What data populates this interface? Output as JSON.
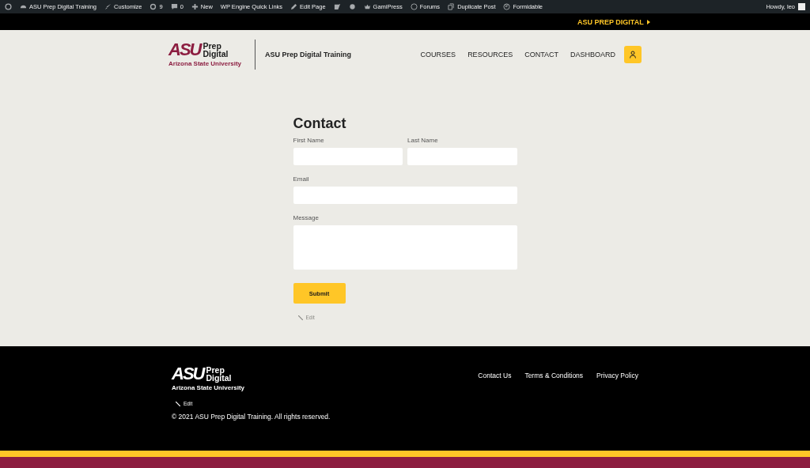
{
  "admin_bar": {
    "items": [
      {
        "kind": "wp"
      },
      {
        "kind": "home",
        "label": "ASU Prep Digital Training"
      },
      {
        "kind": "brush",
        "label": "Customize"
      },
      {
        "kind": "update",
        "label": "9"
      },
      {
        "kind": "comment",
        "label": "0"
      },
      {
        "kind": "plus",
        "label": "New"
      },
      {
        "kind": "text",
        "label": "WP Engine Quick Links"
      },
      {
        "kind": "pencil",
        "label": "Edit Page"
      },
      {
        "kind": "yoast"
      },
      {
        "kind": "dot"
      },
      {
        "kind": "crown",
        "label": "GamiPress"
      },
      {
        "kind": "circle",
        "label": "Forums"
      },
      {
        "kind": "copy",
        "label": "Duplicate Post"
      },
      {
        "kind": "formidable",
        "label": "Formidable"
      }
    ],
    "greeting": "Howdy, leo"
  },
  "top_link": "ASU PREP DIGITAL",
  "header": {
    "logo": {
      "mark": "ASU",
      "name": "Prep Digital",
      "university": "Arizona State University"
    },
    "site_title": "ASU Prep Digital Training",
    "nav": [
      "COURSES",
      "RESOURCES",
      "CONTACT",
      "DASHBOARD"
    ]
  },
  "form": {
    "title": "Contact",
    "fields": [
      {
        "label": "First Name",
        "kind": "input"
      },
      {
        "label": "Last Name",
        "kind": "input"
      },
      {
        "label": "Email",
        "kind": "input"
      },
      {
        "label": "Message",
        "kind": "textarea"
      }
    ],
    "submit": "Submit",
    "edit": "Edit"
  },
  "footer": {
    "logo": {
      "mark": "ASU",
      "name": "Prep Digital",
      "university": "Arizona State University"
    },
    "links": [
      "Contact Us",
      "Terms & Conditions",
      "Privacy Policy"
    ],
    "edit": "Edit",
    "copyright": "© 2021 ASU Prep Digital Training. All rights reserved."
  }
}
